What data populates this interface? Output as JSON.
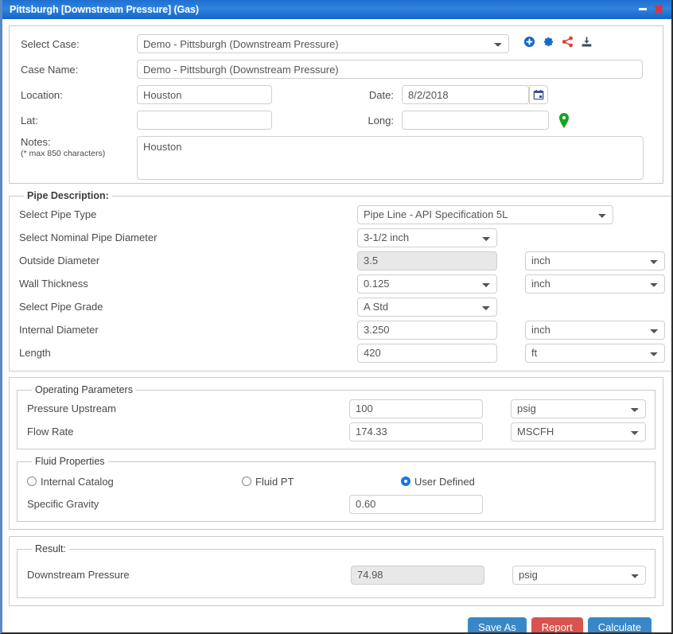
{
  "window": {
    "title": "Pittsburgh [Downstream Pressure] (Gas)",
    "minimize_label": "Minimize",
    "close_label": "Close",
    "titlebar_color": "#1f6fd0"
  },
  "case_panel": {
    "select_case_label": "Select Case:",
    "select_case_value": "Demo - Pittsburgh (Downstream Pressure)",
    "case_name_label": "Case Name:",
    "case_name_value": "Demo - Pittsburgh (Downstream Pressure)",
    "location_label": "Location:",
    "location_value": "Houston",
    "lat_label": "Lat:",
    "lat_value": "",
    "date_label": "Date:",
    "date_value": "8/2/2018",
    "long_label": "Long:",
    "long_value": "",
    "notes_label": "Notes:",
    "notes_hint": "(* max 850 characters)",
    "notes_value": "Houston",
    "icons": {
      "add": "add-circle-icon",
      "settings": "gear-icon",
      "share": "share-icon",
      "download": "download-icon",
      "calendar": "calendar-icon",
      "map_pin": "map-pin-icon"
    },
    "icon_colors": {
      "add": "#1667c8",
      "settings": "#1667c8",
      "share": "#e03b2f",
      "download": "#3d4a57",
      "map_pin": "#17a321"
    }
  },
  "pipe_description": {
    "legend": "Pipe Description:",
    "rows": [
      {
        "label": "Select Pipe Type",
        "value": "Pipe Line - API Specification 5L",
        "kind": "select-wide",
        "unit": null,
        "disabled": false
      },
      {
        "label": "Select Nominal Pipe Diameter",
        "value": "3-1/2 inch",
        "kind": "select",
        "unit": null,
        "disabled": false
      },
      {
        "label": "Outside Diameter",
        "value": "3.5",
        "kind": "input",
        "unit": "inch",
        "disabled": true
      },
      {
        "label": "Wall Thickness",
        "value": "0.125",
        "kind": "select",
        "unit": "inch",
        "disabled": false
      },
      {
        "label": "Select Pipe Grade",
        "value": "A Std",
        "kind": "select",
        "unit": null,
        "disabled": false
      },
      {
        "label": "Internal Diameter",
        "value": "3.250",
        "kind": "input",
        "unit": "inch",
        "disabled": false
      },
      {
        "label": "Length",
        "value": "420",
        "kind": "input",
        "unit": "ft",
        "disabled": false
      }
    ]
  },
  "operating_parameters": {
    "legend": "Operating Parameters",
    "rows": [
      {
        "label": "Pressure Upstream",
        "value": "100",
        "unit": "psig"
      },
      {
        "label": "Flow Rate",
        "value": "174.33",
        "unit": "MSCFH"
      }
    ]
  },
  "fluid_properties": {
    "legend": "Fluid Properties",
    "options": [
      {
        "label": "Internal Catalog",
        "selected": false
      },
      {
        "label": "Fluid PT",
        "selected": false
      },
      {
        "label": "User Defined",
        "selected": true
      }
    ],
    "specific_gravity_label": "Specific Gravity",
    "specific_gravity_value": "0.60",
    "selected_color": "#1677e8"
  },
  "result": {
    "legend": "Result:",
    "label": "Downstream Pressure",
    "value": "74.98",
    "unit": "psig"
  },
  "buttons": {
    "save_as": "Save As",
    "report": "Report",
    "calculate": "Calculate",
    "blue": "#3a87c8",
    "red": "#d9534f"
  }
}
